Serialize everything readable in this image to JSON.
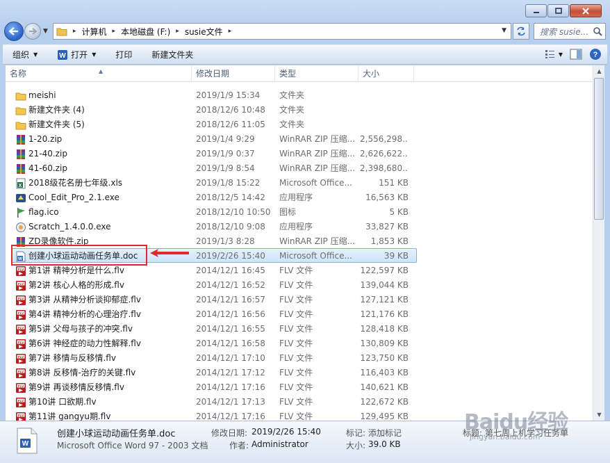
{
  "window": {
    "search_placeholder": "搜索 susie...",
    "breadcrumbs": [
      "计算机",
      "本地磁盘 (F:)",
      "susie文件"
    ]
  },
  "toolbar": {
    "organize": "组织",
    "open": "打开",
    "print": "打印",
    "new_folder": "新建文件夹"
  },
  "columns": {
    "name": "名称",
    "date": "修改日期",
    "type": "类型",
    "size": "大小"
  },
  "files": [
    {
      "name": "meishi",
      "date": "2019/1/9 15:34",
      "type": "文件夹",
      "size": "",
      "icon": "folder-icon"
    },
    {
      "name": "新建文件夹 (4)",
      "date": "2018/12/6 10:48",
      "type": "文件夹",
      "size": "",
      "icon": "folder-icon"
    },
    {
      "name": "新建文件夹 (5)",
      "date": "2018/12/6 11:05",
      "type": "文件夹",
      "size": "",
      "icon": "folder-icon"
    },
    {
      "name": "1-20.zip",
      "date": "2019/1/4 9:29",
      "type": "WinRAR ZIP 压缩...",
      "size": "2,556,298...",
      "icon": "winrar-archive-icon"
    },
    {
      "name": "21-40.zip",
      "date": "2019/1/9 0:37",
      "type": "WinRAR ZIP 压缩...",
      "size": "2,626,622...",
      "icon": "winrar-archive-icon"
    },
    {
      "name": "41-60.zip",
      "date": "2019/1/9 8:54",
      "type": "WinRAR ZIP 压缩...",
      "size": "2,398,680...",
      "icon": "winrar-archive-icon"
    },
    {
      "name": "2018级花名册七年级.xls",
      "date": "2019/1/8 15:22",
      "type": "Microsoft Office...",
      "size": "151 KB",
      "icon": "excel-file-icon"
    },
    {
      "name": "Cool_Edit_Pro_2.1.exe",
      "date": "2018/12/5 14:42",
      "type": "应用程序",
      "size": "16,563 KB",
      "icon": "exe-app-icon"
    },
    {
      "name": "flag.ico",
      "date": "2018/12/10 10:50",
      "type": "图标",
      "size": "5 KB",
      "icon": "flag-icon"
    },
    {
      "name": "Scratch_1.4.0.0.exe",
      "date": "2018/12/10 9:08",
      "type": "应用程序",
      "size": "33,827 KB",
      "icon": "scratch-app-icon"
    },
    {
      "name": "ZD录像软件.zip",
      "date": "2019/1/3 8:28",
      "type": "WinRAR ZIP 压缩...",
      "size": "1,853 KB",
      "icon": "winrar-archive-icon"
    },
    {
      "name": "创建小球运动动画任务单.doc",
      "date": "2019/2/26 15:40",
      "type": "Microsoft Office...",
      "size": "39 KB",
      "icon": "word-doc-icon",
      "selected": true
    },
    {
      "name": "第1讲 精神分析是什么.flv",
      "date": "2014/12/1 16:45",
      "type": "FLV 文件",
      "size": "122,597 KB",
      "icon": "flv-file-icon"
    },
    {
      "name": "第2讲 核心人格的形成.flv",
      "date": "2014/12/1 16:52",
      "type": "FLV 文件",
      "size": "139,044 KB",
      "icon": "flv-file-icon"
    },
    {
      "name": "第3讲 从精神分析谈抑郁症.flv",
      "date": "2014/12/1 16:57",
      "type": "FLV 文件",
      "size": "127,121 KB",
      "icon": "flv-file-icon"
    },
    {
      "name": "第4讲 精神分析的心理治疗.flv",
      "date": "2014/12/1 16:56",
      "type": "FLV 文件",
      "size": "121,176 KB",
      "icon": "flv-file-icon"
    },
    {
      "name": "第5讲 父母与孩子的冲突.flv",
      "date": "2014/12/1 16:55",
      "type": "FLV 文件",
      "size": "128,418 KB",
      "icon": "flv-file-icon"
    },
    {
      "name": "第6讲 神经症的动力性解释.flv",
      "date": "2014/12/1 16:58",
      "type": "FLV 文件",
      "size": "130,809 KB",
      "icon": "flv-file-icon"
    },
    {
      "name": "第7讲 移情与反移情.flv",
      "date": "2014/12/1 17:10",
      "type": "FLV 文件",
      "size": "123,750 KB",
      "icon": "flv-file-icon"
    },
    {
      "name": "第8讲 反移情-治疗的关键.flv",
      "date": "2014/12/1 17:12",
      "type": "FLV 文件",
      "size": "116,403 KB",
      "icon": "flv-file-icon"
    },
    {
      "name": "第9讲 再谈移情反移情.flv",
      "date": "2014/12/1 17:16",
      "type": "FLV 文件",
      "size": "140,621 KB",
      "icon": "flv-file-icon"
    },
    {
      "name": "第10讲 口欲期.flv",
      "date": "2014/12/1 17:13",
      "type": "FLV 文件",
      "size": "122,672 KB",
      "icon": "flv-file-icon"
    },
    {
      "name": "第11讲 gangyu期.flv",
      "date": "2014/12/1 17:16",
      "type": "FLV 文件",
      "size": "129,495 KB",
      "icon": "flv-file-icon"
    }
  ],
  "details": {
    "name": "创建小球运动动画任务单.doc",
    "kind": "Microsoft Office Word 97 - 2003 文档",
    "modified_label": "修改日期:",
    "modified_value": "2019/2/26 15:40",
    "author_label": "作者:",
    "author_value": "Administrator",
    "tags_label": "标记:",
    "tags_value": "添加标记",
    "size_label": "大小:",
    "size_value": "39.0 KB",
    "title_label": "标题:",
    "title_value": "第七周上机学习任务单"
  },
  "watermark": {
    "brand": "Baidu经验",
    "url": "jingyan.baidu.com"
  },
  "colors": {
    "selection": "#cde4fb",
    "highlight_box": "#e0292b"
  }
}
